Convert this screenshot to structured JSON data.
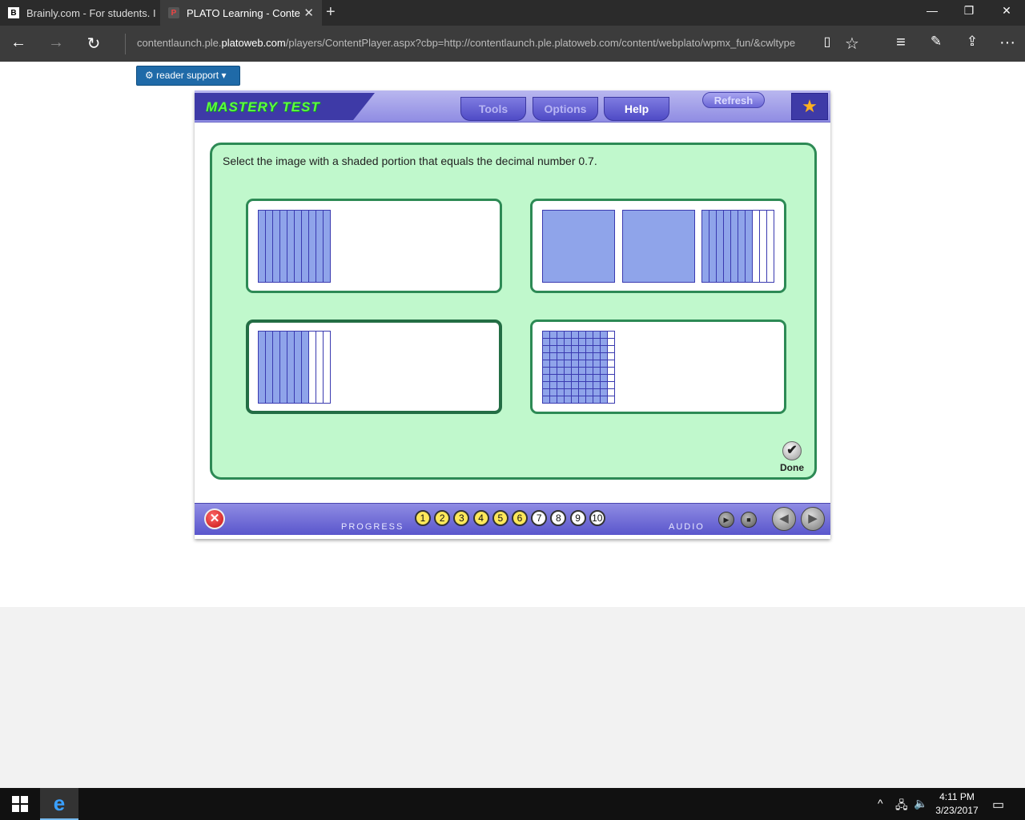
{
  "browser": {
    "tabs": [
      {
        "favicon": "B",
        "title": "Brainly.com - For students. I"
      },
      {
        "favicon": "P",
        "title": "PLATO Learning - Conte"
      }
    ],
    "url_prefix": "contentlaunch.ple.",
    "url_domain": "platoweb.com",
    "url_rest": "/players/ContentPlayer.aspx?cbp=http://contentlaunch.ple.platoweb.com/content/webplato/wpmx_fun/&cwltype"
  },
  "page": {
    "reader_support": "reader support"
  },
  "player": {
    "title": "MASTERY TEST",
    "tabs": [
      "Tools",
      "Options",
      "Help"
    ],
    "refresh": "Refresh",
    "question": "Select the image with a shaded portion that equals the decimal number 0.7.",
    "choices": [
      {
        "description": "one tenths strip with 10 of 10 columns shaded",
        "wholes_shaded": 0,
        "tenths_shaded": 10
      },
      {
        "description": "two shaded wholes plus tenths strip with 7 of 10 columns shaded",
        "wholes_shaded": 2,
        "tenths_shaded": 7
      },
      {
        "description": "one tenths strip with 7 of 10 columns shaded",
        "wholes_shaded": 0,
        "tenths_shaded": 7,
        "selected": true
      },
      {
        "description": "hundredths grid with 90 of 100 squares shaded",
        "hundredths_shaded": 90
      }
    ],
    "done_label": "Done",
    "progress_label": "PROGRESS",
    "progress": [
      "1",
      "2",
      "3",
      "4",
      "5",
      "6",
      "7",
      "8",
      "9",
      "10"
    ],
    "progress_completed": 6,
    "audio_label": "AUDIO"
  },
  "taskbar": {
    "time": "4:11 PM",
    "date": "3/23/2017"
  },
  "colors": {
    "shade": "#8fa4ea",
    "line": "#3a3ab0",
    "content_bg": "#c0f8cc",
    "content_border": "#2d8a55"
  }
}
